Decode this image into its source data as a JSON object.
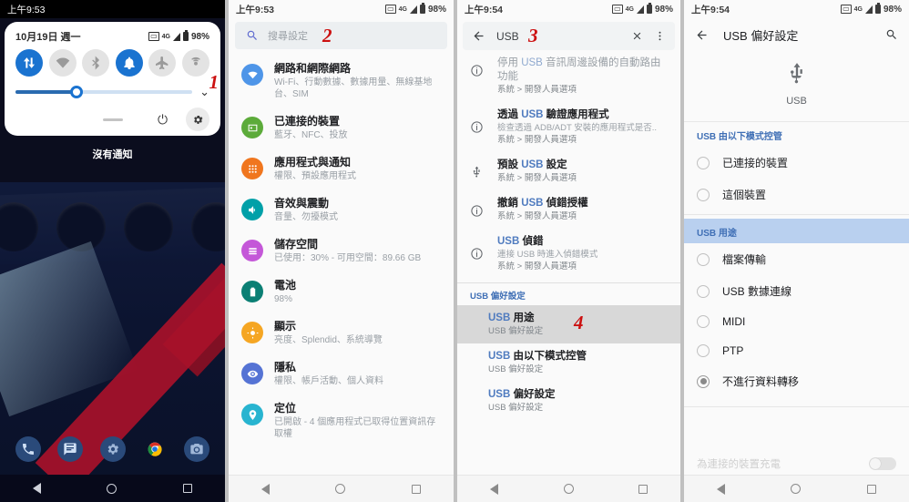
{
  "panel1": {
    "status": {
      "time": "上午9:53",
      "battery": "98%",
      "network": "4G"
    },
    "quick_settings": {
      "date": "10月19日 週一",
      "battery": "98%",
      "tiles": [
        {
          "name": "mobile-data",
          "icon": "data-arrows-icon",
          "on": true
        },
        {
          "name": "wifi",
          "icon": "wifi-icon",
          "on": false
        },
        {
          "name": "bluetooth",
          "icon": "bluetooth-icon",
          "on": false
        },
        {
          "name": "ring-mode",
          "icon": "bell-icon",
          "on": true
        },
        {
          "name": "airplane-mode",
          "icon": "airplane-icon",
          "on": false
        },
        {
          "name": "hotspot",
          "icon": "hotspot-icon",
          "on": false
        }
      ],
      "brightness_percent": 33
    },
    "no_notifications": "沒有通知",
    "dock": [
      {
        "name": "phone",
        "icon": "phone-icon"
      },
      {
        "name": "messages",
        "icon": "message-icon"
      },
      {
        "name": "settings",
        "icon": "gear-icon"
      },
      {
        "name": "chrome",
        "icon": "chrome-icon"
      },
      {
        "name": "camera",
        "icon": "camera-icon"
      }
    ],
    "marker": "1"
  },
  "panel2": {
    "status": {
      "time": "上午9:53",
      "battery": "98%",
      "network": "4G"
    },
    "search": {
      "placeholder": "搜尋設定"
    },
    "marker": "2",
    "items": [
      {
        "title": "網路和網際網路",
        "desc": "Wi-Fi、行動數據、數據用量、無線基地台、SIM",
        "color": "#4e95e8",
        "icon": "wifi-icon"
      },
      {
        "title": "已連接的裝置",
        "desc": "藍牙、NFC、投放",
        "color": "#5cab3a",
        "icon": "cast-icon"
      },
      {
        "title": "應用程式與通知",
        "desc": "權限、預設應用程式",
        "color": "#f0761e",
        "icon": "apps-grid-icon"
      },
      {
        "title": "音效與震動",
        "desc": "音量、勿擾模式",
        "color": "#00a0a8",
        "icon": "volume-icon"
      },
      {
        "title": "儲存空間",
        "desc": "已使用：30% - 可用空間：89.66 GB",
        "color": "#c457d8",
        "icon": "storage-icon"
      },
      {
        "title": "電池",
        "desc": "98%",
        "color": "#0b7f74",
        "icon": "battery-icon"
      },
      {
        "title": "顯示",
        "desc": "亮度、Splendid、系統導覽",
        "color": "#f5a623",
        "icon": "brightness-icon"
      },
      {
        "title": "隱私",
        "desc": "權限、帳戶活動、個人資料",
        "color": "#5573d4",
        "icon": "eye-icon"
      },
      {
        "title": "定位",
        "desc": "已開啟 - 4 個應用程式已取得位置資訊存取權",
        "color": "#28b4d0",
        "icon": "location-pin-icon"
      }
    ]
  },
  "panel3": {
    "status": {
      "time": "上午9:54",
      "battery": "98%",
      "network": "4G"
    },
    "search": {
      "query": "USB"
    },
    "marker_header": "3",
    "marker_row": "4",
    "results": [
      {
        "title_prefix": "停用 ",
        "title_kw": "USB",
        "title_suffix": " 音訊周邊設備的自動路由功能",
        "desc": "系統 > 開發人員選項",
        "icon": "info-icon",
        "bold": false
      },
      {
        "title_prefix": "透過 ",
        "title_kw": "USB",
        "title_suffix": " 驗證應用程式",
        "desc": "檢查透過 ADB/ADT 安裝的應用程式是否..",
        "desc2": "系統 > 開發人員選項",
        "icon": "info-icon",
        "bold": true
      },
      {
        "title_prefix": "預設 ",
        "title_kw": "USB",
        "title_suffix": " 設定",
        "desc": "系統 > 開發人員選項",
        "icon": "usb-icon",
        "bold": true
      },
      {
        "title_prefix": "撤銷 ",
        "title_kw": "USB",
        "title_suffix": " 偵錯授權",
        "desc": "系統 > 開發人員選項",
        "icon": "info-icon",
        "bold": true
      },
      {
        "title_prefix": "",
        "title_kw": "USB",
        "title_suffix": " 偵錯",
        "desc": "連接 USB 時進入偵錯模式",
        "desc2": "系統 > 開發人員選項",
        "icon": "info-icon",
        "bold": true
      }
    ],
    "section_header": {
      "kw": "USB",
      "rest": " 偏好設定"
    },
    "pref_results": [
      {
        "title_kw": "USB",
        "title_suffix": " 用途",
        "desc": "USB 偏好設定",
        "selected": true
      },
      {
        "title_kw": "USB",
        "title_suffix": " 由以下模式控管",
        "desc": "USB 偏好設定",
        "selected": false
      },
      {
        "title_kw": "USB",
        "title_suffix": " 偏好設定",
        "desc": "USB 偏好設定",
        "selected": false
      }
    ]
  },
  "panel4": {
    "status": {
      "time": "上午9:54",
      "battery": "98%",
      "network": "4G"
    },
    "appbar": {
      "title": "USB 偏好設定",
      "back_icon": "arrow-back-icon",
      "search_icon": "search-icon"
    },
    "hero": {
      "icon": "usb-icon",
      "label": "USB"
    },
    "group1": {
      "header": "USB 由以下模式控管",
      "options": [
        {
          "label": "已連接的裝置",
          "selected": false
        },
        {
          "label": "這個裝置",
          "selected": false
        }
      ]
    },
    "group2": {
      "header": "USB 用途",
      "highlighted": true,
      "options": [
        {
          "label": "檔案傳輸",
          "selected": false
        },
        {
          "label": "USB 數據連線",
          "selected": false
        },
        {
          "label": "MIDI",
          "selected": false
        },
        {
          "label": "PTP",
          "selected": false
        },
        {
          "label": "不進行資料轉移",
          "selected": true
        }
      ]
    },
    "footer_toggle": {
      "label": "為連接的裝置充電",
      "on": false
    }
  },
  "colors": {
    "accent": "#1a73d0",
    "link": "#4f7bbf",
    "marker": "#cc1111",
    "highlight": "#b9d0ef"
  }
}
